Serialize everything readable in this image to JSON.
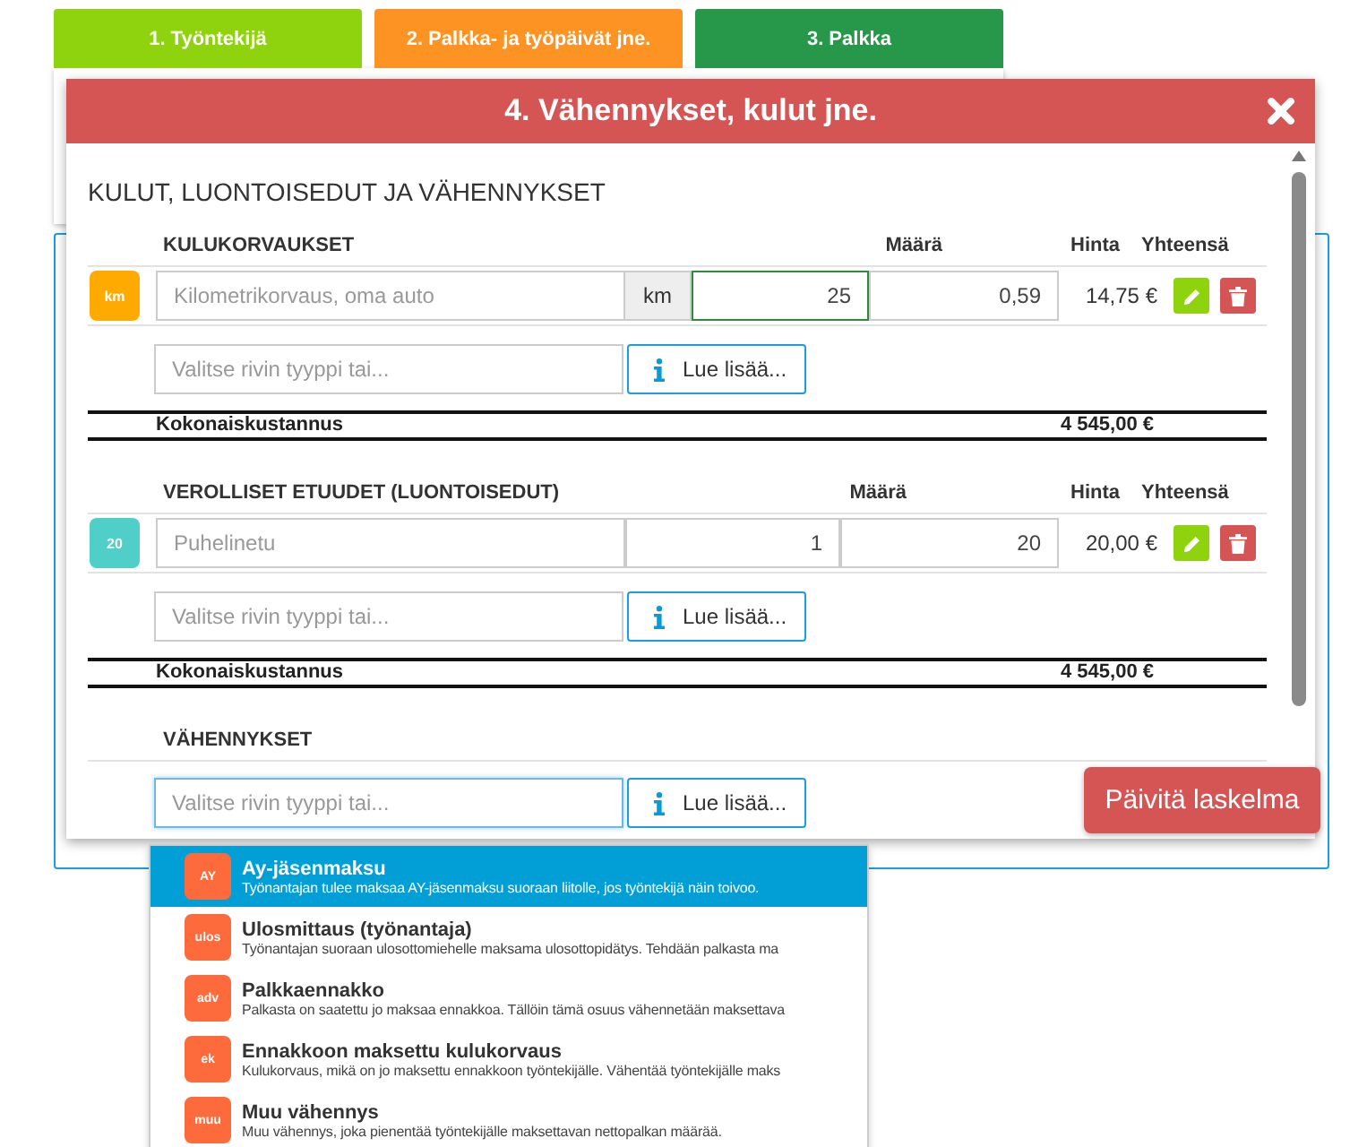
{
  "tabs": [
    {
      "label": "1. Työntekijä",
      "color": "#8fd30f"
    },
    {
      "label": "2. Palkka- ja työpäivät jne.",
      "color": "#fc9322"
    },
    {
      "label": "3. Palkka",
      "color": "#27984a"
    }
  ],
  "modal": {
    "title": "4. Vähennykset, kulut jne.",
    "heading": "KULUT, LUONTOISEDUT JA VÄHENNYKSET",
    "sections": [
      {
        "title": "KULUKORVAUKSET",
        "amount_header": "Määrä",
        "price_header": "Hinta",
        "total_header": "Yhteensä",
        "rows": [
          {
            "badge": "km",
            "color": "#ffaa00",
            "name_placeholder": "Kilometrikorvaus, oma auto",
            "unit": "km",
            "amount": "25",
            "amount_focused": true,
            "price": "0,59",
            "total": "14,75 €"
          }
        ],
        "selector": {
          "placeholder": "Valitse rivin tyyppi tai...",
          "focused": false
        },
        "info_button": "Lue lisää...",
        "total_label": "Kokonaiskustannus",
        "total_value": "4 545,00 €"
      },
      {
        "title": "VEROLLISET ETUUDET (LUONTOISEDUT)",
        "amount_header": "Määrä",
        "price_header": "Hinta",
        "total_header": "Yhteensä",
        "rows": [
          {
            "badge": "20",
            "color": "#4fcfc8",
            "name_placeholder": "Puhelinetu",
            "amount": "1",
            "amount_focused": false,
            "price": "20",
            "total": "20,00 €"
          }
        ],
        "selector": {
          "placeholder": "Valitse rivin tyyppi tai...",
          "focused": false
        },
        "info_button": "Lue lisää...",
        "total_label": "Kokonaiskustannus",
        "total_value": "4 545,00 €"
      },
      {
        "title": "VÄHENNYKSET",
        "selector": {
          "placeholder": "Valitse rivin tyyppi tai...",
          "focused": true
        },
        "info_button": "Lue lisää..."
      }
    ]
  },
  "update_button": "Päivitä laskelma",
  "dropdown": [
    {
      "badge": "AY",
      "title": "Ay-jäsenmaksu",
      "description": "Työnantajan tulee maksaa AY-jäsenmaksu suoraan liitolle, jos työntekijä näin toivoo.",
      "selected": true
    },
    {
      "badge": "ulos",
      "title": "Ulosmittaus (työnantaja)",
      "description": "Työnantajan suoraan ulosottomiehelle maksama ulosottopidätys. Tehdään palkasta ma",
      "selected": false
    },
    {
      "badge": "adv",
      "title": "Palkkaennakko",
      "description": "Palkasta on saatettu jo maksaa ennakkoa. Tällöin tämä osuus vähennetään maksettava",
      "selected": false
    },
    {
      "badge": "ek",
      "title": "Ennakkoon maksettu kulukorvaus",
      "description": "Kulukorvaus, mikä on jo maksettu ennakkoon työntekijälle. Vähentää työntekijälle maks",
      "selected": false
    },
    {
      "badge": "muu",
      "title": "Muu vähennys",
      "description": "Muu vähennys, joka pienentää työntekijälle maksettavan nettopalkan määrää.",
      "selected": false
    }
  ]
}
